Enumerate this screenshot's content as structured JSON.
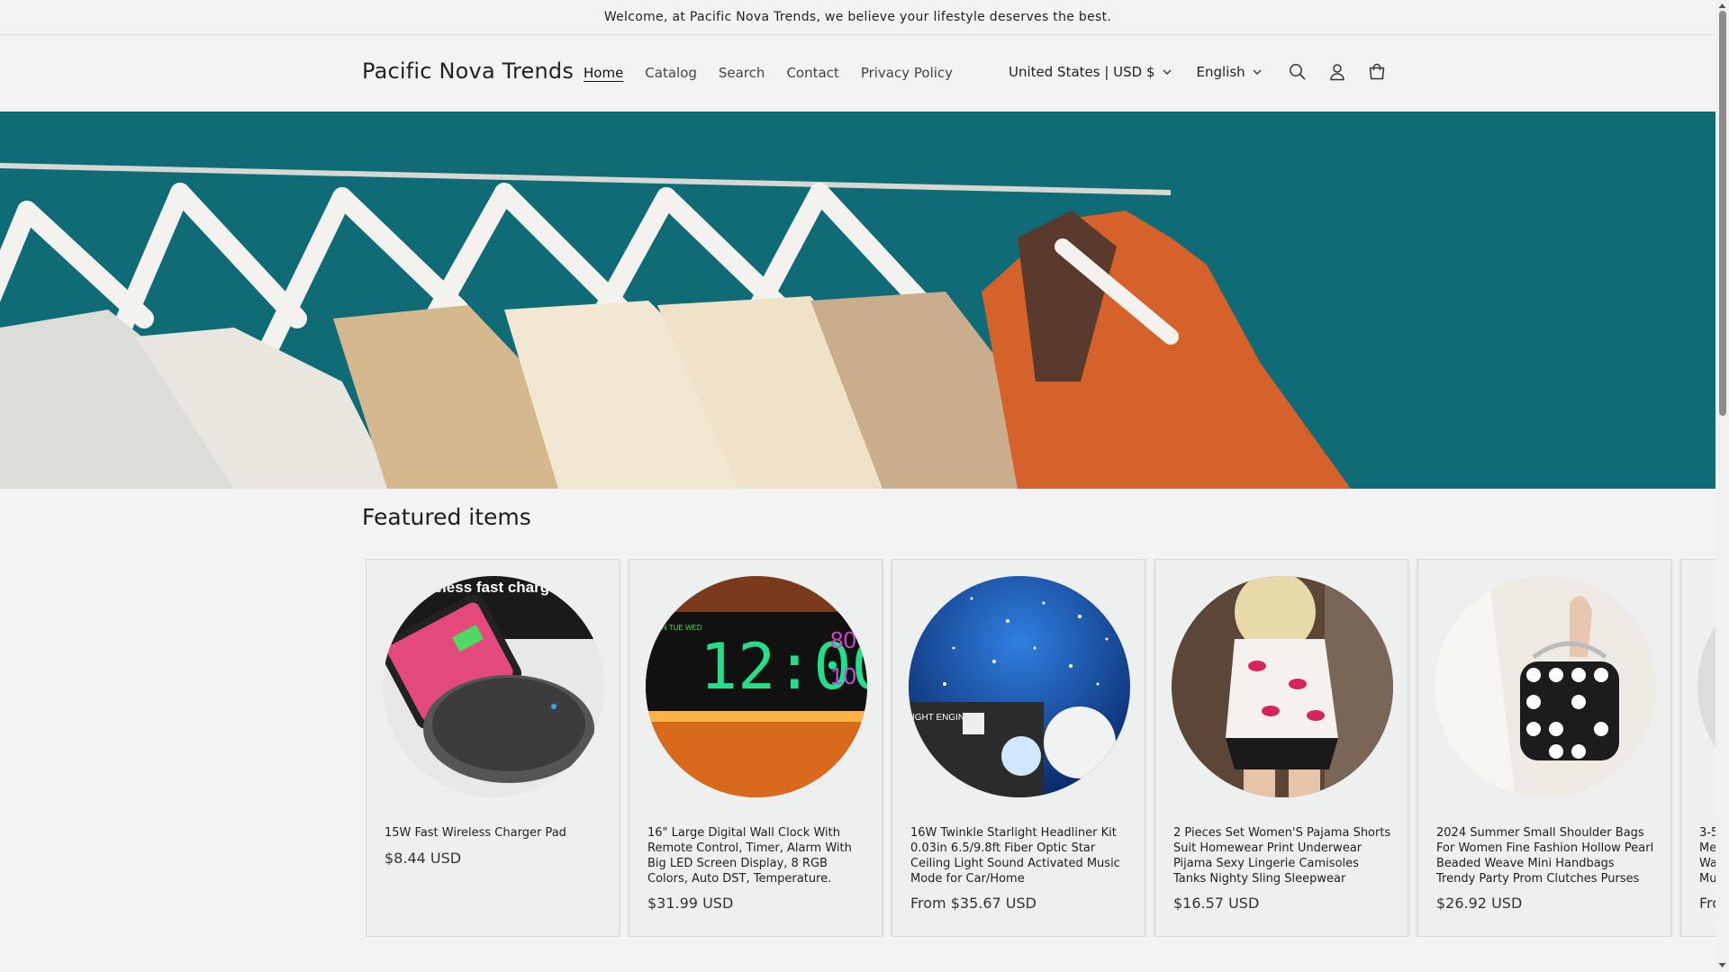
{
  "announcement": "Welcome, at Pacific Nova Trends, we believe your lifestyle deserves the best.",
  "header": {
    "logo": "Pacific Nova Trends",
    "nav": [
      "Home",
      "Catalog",
      "Search",
      "Contact",
      "Privacy Policy"
    ],
    "active_nav": "Home",
    "country": "United States | USD $",
    "language": "English",
    "icons": [
      "search-icon",
      "account-icon",
      "cart-icon"
    ]
  },
  "featured": {
    "title": "Featured items",
    "products": [
      {
        "title": "15W Fast Wireless Charger Pad",
        "price": "$8.44 USD",
        "image_text": "reless fast charg"
      },
      {
        "title": "16\" Large Digital Wall Clock With Remote Control, Timer, Alarm With Big LED Screen Display, 8 RGB Colors, Auto DST, Temperature.",
        "price": "$31.99 USD",
        "image_text": "12:00"
      },
      {
        "title": "16W Twinkle Starlight Headliner Kit 0.03in 6.5/9.8ft Fiber Optic Star Ceiling Light Sound Activated Music Mode for Car/Home",
        "price": "From $35.67 USD",
        "image_text": "IGHT ENGINE"
      },
      {
        "title": "2 Pieces Set Women'S Pajama Shorts Suit Homewear Print Underwear Pijama Sexy Lingerie Camisoles Tanks Nighty Sling Sleepwear",
        "price": "$16.57 USD",
        "image_text": ""
      },
      {
        "title": "2024 Summer Small Shoulder Bags For Women Fine Fashion Hollow Pearl Beaded Weave Mini Handbags Trendy Party Prom Clutches Purses",
        "price": "$26.92 USD",
        "image_text": ""
      },
      {
        "title": "3-5 Me Wa Mu",
        "price": "Fro",
        "image_text": ""
      }
    ]
  },
  "colors": {
    "background": "#f3f3f3",
    "hero_teal": "#0f6b76",
    "card_bg": "#eef0f0"
  }
}
